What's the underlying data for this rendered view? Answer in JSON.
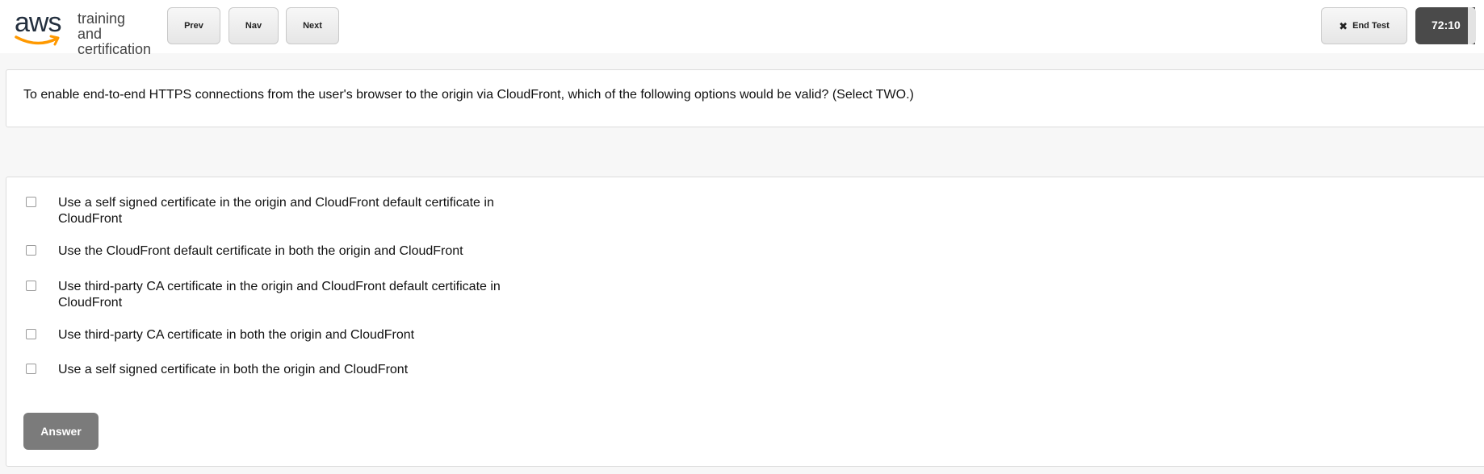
{
  "header": {
    "logo": {
      "wordmark": "aws",
      "tagline_line1": "training and",
      "tagline_line2": "certification"
    },
    "buttons": {
      "prev": "Prev",
      "nav": "Nav",
      "next": "Next",
      "end_test": "End Test"
    },
    "timer": "72:10"
  },
  "question": {
    "text": "To enable end-to-end HTTPS connections from the user's browser to the origin via CloudFront, which of the following options would be valid? (Select TWO.)"
  },
  "options": [
    {
      "label": "Use a self signed certificate in the origin and CloudFront default certificate in CloudFront",
      "checked": false
    },
    {
      "label": "Use the CloudFront default certificate in both the origin and CloudFront",
      "checked": false
    },
    {
      "label": "Use third-party CA certificate in the origin and CloudFront default certificate in CloudFront",
      "checked": false
    },
    {
      "label": "Use third-party CA certificate in both the origin and CloudFront",
      "checked": false
    },
    {
      "label": "Use a self signed certificate in both the origin and CloudFront",
      "checked": false
    }
  ],
  "answer_button": "Answer",
  "icons": {
    "end_test": "close-icon"
  },
  "colors": {
    "logo_smile": "#ff9900",
    "timer_bg": "#4a4a4a",
    "answer_bg": "#7b7b7b"
  }
}
